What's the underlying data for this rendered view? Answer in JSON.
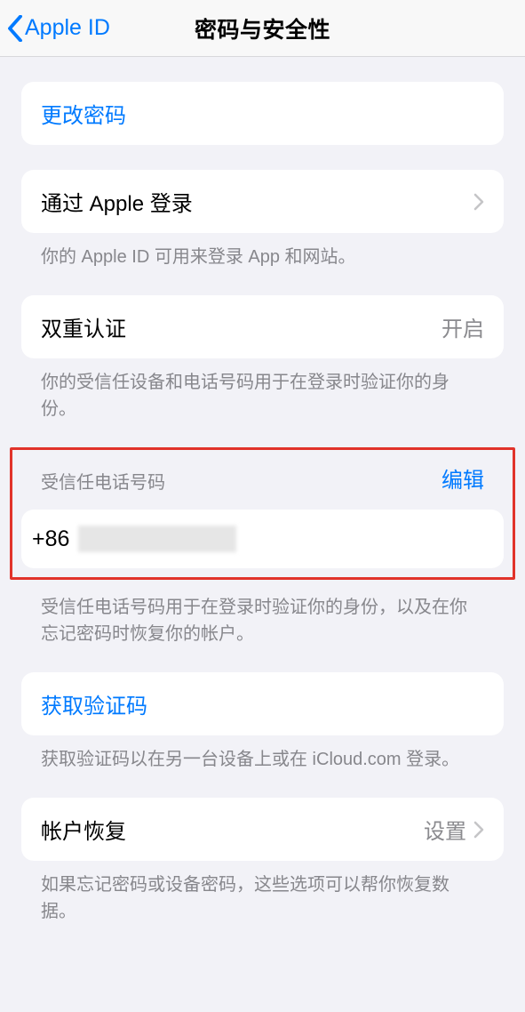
{
  "nav": {
    "back_label": "Apple ID",
    "title": "密码与安全性"
  },
  "change_password": {
    "label": "更改密码"
  },
  "sign_in_with_apple": {
    "label": "通过 Apple 登录",
    "footer": "你的 Apple ID 可用来登录 App 和网站。"
  },
  "two_factor": {
    "label": "双重认证",
    "value": "开启",
    "footer": "你的受信任设备和电话号码用于在登录时验证你的身份。"
  },
  "trusted_phone": {
    "section_title": "受信任电话号码",
    "edit_label": "编辑",
    "prefix": "+86",
    "footer": "受信任电话号码用于在登录时验证你的身份，以及在你忘记密码时恢复你的帐户。"
  },
  "get_code": {
    "label": "获取验证码",
    "footer": "获取验证码以在另一台设备上或在 iCloud.com 登录。"
  },
  "account_recovery": {
    "label": "帐户恢复",
    "value": "设置",
    "footer": "如果忘记密码或设备密码，这些选项可以帮你恢复数据。"
  }
}
